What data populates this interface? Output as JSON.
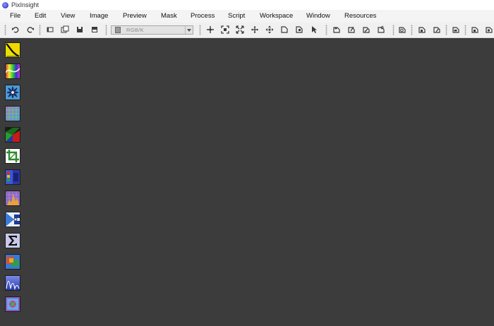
{
  "window": {
    "title": "PixInsight"
  },
  "menu": [
    "File",
    "Edit",
    "View",
    "Image",
    "Preview",
    "Mask",
    "Process",
    "Script",
    "Workspace",
    "Window",
    "Resources"
  ],
  "toolbar": {
    "color_space": "RGB/K"
  },
  "desktop_tools": [
    "curves-transformation-icon",
    "color-saturation-icon",
    "star-mask-icon",
    "dynamic-background-icon",
    "color-calibration-icon",
    "dynamic-crop-icon",
    "channel-combination-icon",
    "histogram-icon",
    "image-integration-icon",
    "pixelmath-icon",
    "lrgb-combination-icon",
    "multiscale-transform-icon",
    "deconvolution-icon"
  ]
}
